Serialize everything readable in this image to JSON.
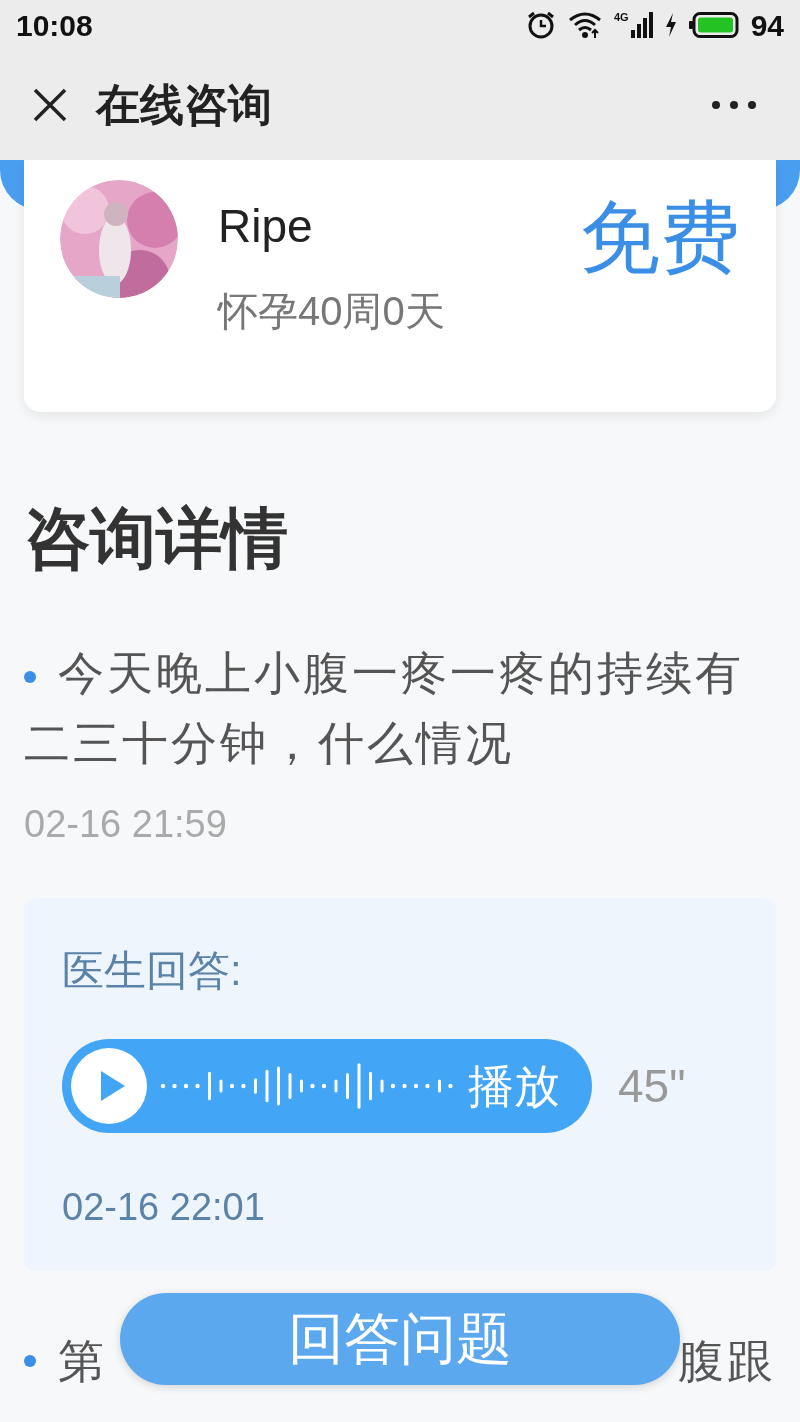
{
  "status_bar": {
    "time": "10:08",
    "network": "4G",
    "battery": "94"
  },
  "header": {
    "title": "在线咨询"
  },
  "profile": {
    "name": "Ripe",
    "status": "怀孕40周0天",
    "price": "免费"
  },
  "section_title": "咨询详情",
  "questions": [
    {
      "kind": "full",
      "text": "今天晚上小腹一疼一疼的持续有二三十分钟，什么情况",
      "time": "02-16 21:59",
      "answer": {
        "label": "医生回答:",
        "play_label": "播放",
        "duration": "45\"",
        "time": "02-16 22:01"
      }
    },
    {
      "kind": "covered",
      "start": "第",
      "end": "腹跟"
    }
  ],
  "answer_button": "回答问题"
}
